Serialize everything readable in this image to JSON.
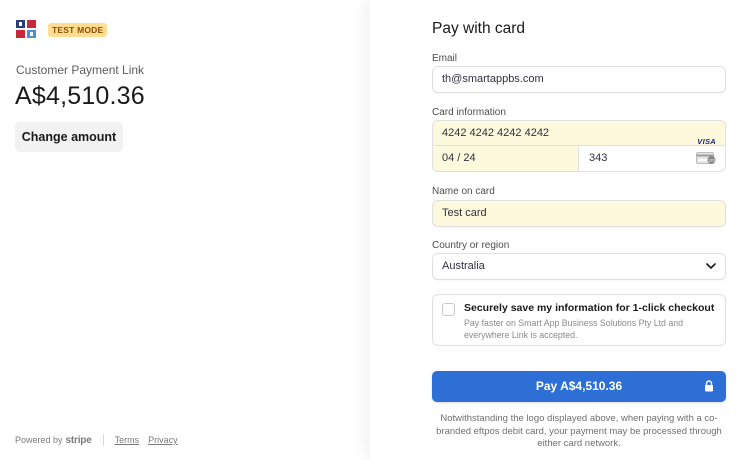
{
  "left": {
    "test_mode_badge": "TEST MODE",
    "product_name": "Customer Payment Link",
    "amount": "A$4,510.36",
    "change_amount_label": "Change amount",
    "footer": {
      "powered_by": "Powered by",
      "brand": "stripe",
      "terms": "Terms",
      "privacy": "Privacy"
    }
  },
  "form": {
    "heading": "Pay with card",
    "email_label": "Email",
    "email_value": "th@smartappbs.com",
    "card_info_label": "Card information",
    "card_number": "4242 4242 4242 4242",
    "card_brand": "VISA",
    "card_expiry": "04 / 24",
    "card_cvc": "343",
    "name_label": "Name on card",
    "name_value": "Test card",
    "country_label": "Country or region",
    "country_value": "Australia",
    "save_info_title": "Securely save my information for 1-click checkout",
    "save_info_desc": "Pay faster on Smart App Business Solutions Pty Ltd and everywhere Link is accepted.",
    "save_info_checked": false,
    "pay_button_label": "Pay A$4,510.36",
    "notice": "Notwithstanding the logo displayed above, when paying with a co-branded eftpos debit card, your payment may be processed through either card network."
  },
  "icons": {
    "logo": "business-logo-icon",
    "card_brand": "visa-icon",
    "cvc": "cvc-card-icon",
    "select_arrow": "chevron-down-icon",
    "pay_lock": "lock-icon"
  },
  "colors": {
    "accent": "#2d6fd5",
    "autofill_background": "#fcf9dd",
    "test_badge_background": "#ffde92",
    "test_badge_text": "#8f4f00"
  }
}
